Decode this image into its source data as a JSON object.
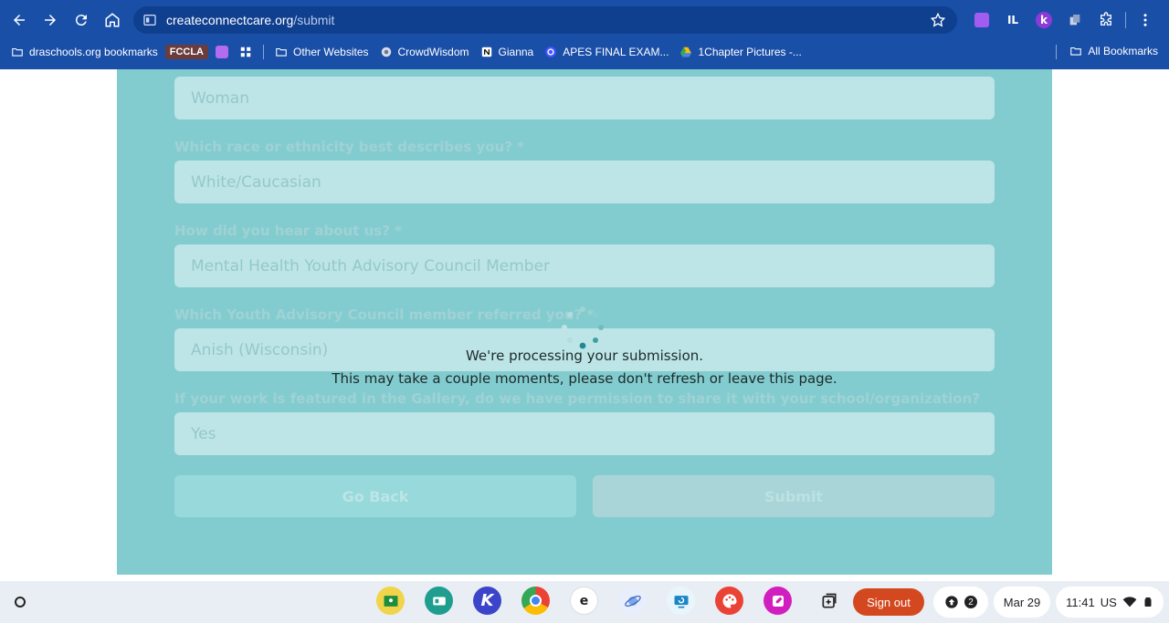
{
  "browser": {
    "url_host": "createconnectcare.org",
    "url_path": "/submit",
    "bookmarks": [
      {
        "label": "draschools.org bookmarks"
      },
      {
        "label": "FCCLA"
      },
      {
        "label": "Other Websites"
      },
      {
        "label": "CrowdWisdom"
      },
      {
        "label": "Gianna"
      },
      {
        "label": "APES FINAL EXAM..."
      },
      {
        "label": "1Chapter Pictures -..."
      }
    ],
    "all_bookmarks": "All Bookmarks",
    "extensions": [
      "IL",
      "k"
    ]
  },
  "form": {
    "gender_value": "Woman",
    "q_race": "Which race or ethnicity best describes you? *",
    "race_value": "White/Caucasian",
    "q_hear": "How did you hear about us? *",
    "hear_value": "Mental Health Youth Advisory Council Member",
    "q_referred": "Which Youth Advisory Council member referred you? *",
    "referred_value": "Anish (Wisconsin)",
    "q_permission": "If your work is featured in the Gallery, do we have permission to share it with your school/organization?",
    "permission_value": "Yes",
    "go_back": "Go Back",
    "submit": "Submit"
  },
  "overlay": {
    "line1": "We're processing your submission.",
    "line2": "This may take a couple moments, please don't refresh or leave this page."
  },
  "shelf": {
    "sign_out": "Sign out",
    "notification_count": "2",
    "date": "Mar 29",
    "time": "11:41",
    "locale": "US"
  }
}
